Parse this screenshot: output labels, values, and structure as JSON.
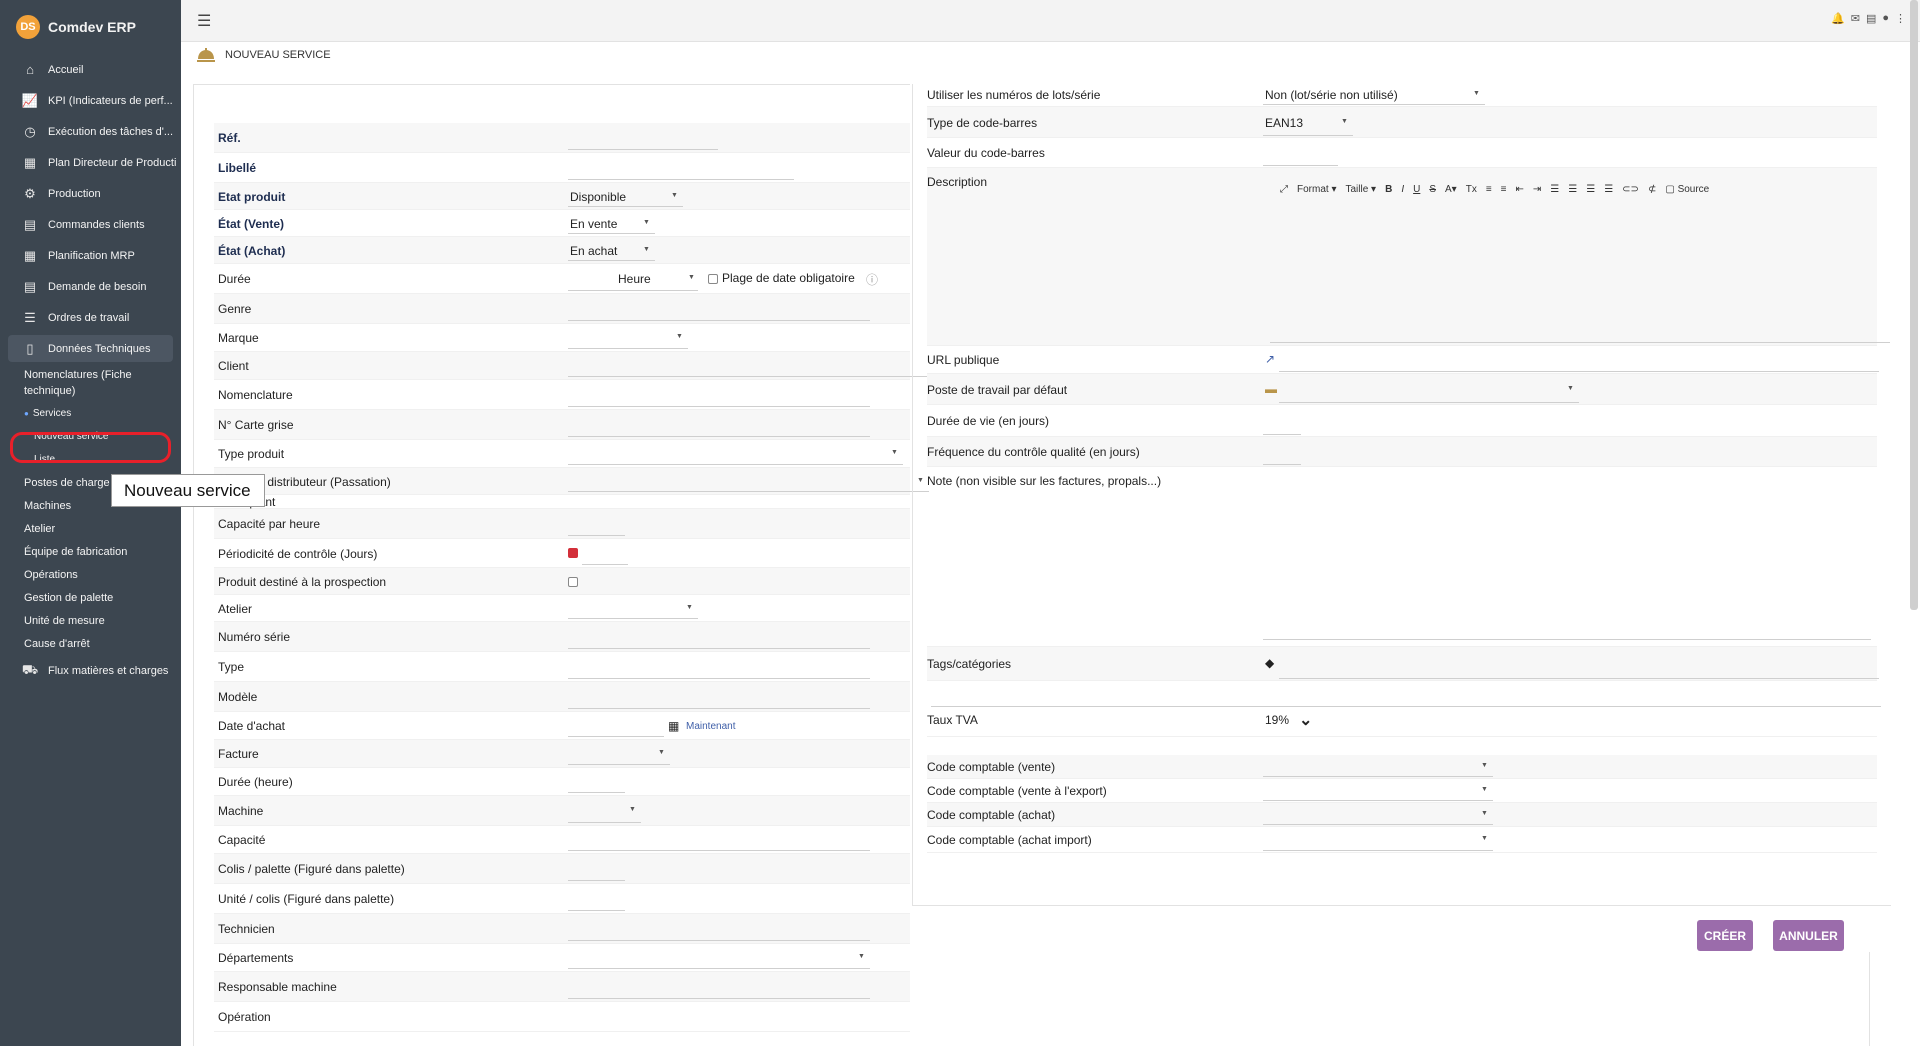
{
  "app": {
    "name": "Comdev ERP",
    "logo_text": "DS"
  },
  "sidebar": {
    "items": [
      {
        "label": "Accueil",
        "icon": "home-icon",
        "glyph": "⌂"
      },
      {
        "label": "KPI (Indicateurs de perf...",
        "icon": "chart-line-icon",
        "glyph": "📈"
      },
      {
        "label": "Exécution des tâches d'...",
        "icon": "clock-icon",
        "glyph": "◷"
      },
      {
        "label": "Plan Directeur de Producti",
        "icon": "calendar-icon",
        "glyph": "▦"
      },
      {
        "label": "Production",
        "icon": "cogs-icon",
        "glyph": "⚙"
      },
      {
        "label": "Commandes clients",
        "icon": "file-icon",
        "glyph": "▤"
      },
      {
        "label": "Planification MRP",
        "icon": "calendar-icon",
        "glyph": "▦"
      },
      {
        "label": "Demande de besoin",
        "icon": "file-icon",
        "glyph": "▤"
      },
      {
        "label": "Ordres de travail",
        "icon": "tasks-icon",
        "glyph": "☰"
      },
      {
        "label": "Données Techniques",
        "icon": "document-icon",
        "glyph": "▯"
      }
    ],
    "sub_nomenclatures": "Nomenclatures (Fiche technique)",
    "sub_services": "Services",
    "sub_nouveau_service": "Nouveau service",
    "sub_liste": "Liste",
    "sub_items": [
      "Postes de charge",
      "Machines",
      "Atelier",
      "Équipe de fabrication",
      "Opérations",
      "Gestion de palette",
      "Unité de mesure",
      "Cause d'arrêt"
    ],
    "flux_label": "Flux matières et charges",
    "flux_glyph": "⛟",
    "tooltip": "Nouveau service"
  },
  "page": {
    "title": "NOUVEAU SERVICE"
  },
  "left_form": {
    "ref": "Réf.",
    "libelle": "Libellé",
    "etat_produit": "Etat produit",
    "etat_produit_val": "Disponible",
    "etat_vente": "État (Vente)",
    "etat_vente_val": "En vente",
    "etat_achat": "État (Achat)",
    "etat_achat_val": "En achat",
    "duree": "Durée",
    "duree_unit": "Heure",
    "plage_date": "Plage de date obligatoire",
    "genre": "Genre",
    "marque": "Marque",
    "client": "Client",
    "nomenclature": "Nomenclature",
    "carte_grise": "N° Carte grise",
    "type_produit": "Type produit",
    "releve": "... relevé distributeur (Passation)",
    "fabriquant": "Fabriquant",
    "capacite_heure": "Capacité par heure",
    "periodicite": "Périodicité de contrôle (Jours)",
    "prospection": "Produit destiné à la prospection",
    "atelier": "Atelier",
    "numero_serie": "Numéro série",
    "type": "Type",
    "modele": "Modèle",
    "date_achat": "Date d'achat",
    "maintenant": "Maintenant",
    "facture": "Facture",
    "duree_heure": "Durée (heure)",
    "machine": "Machine",
    "capacite": "Capacité",
    "colis_palette": "Colis / palette (Figuré dans palette)",
    "unite_colis": "Unité / colis (Figuré dans palette)",
    "technicien": "Technicien",
    "departements": "Départements",
    "responsable": "Responsable machine",
    "operation": "Opération"
  },
  "right_form": {
    "lots": "Utiliser les numéros de lots/série",
    "lots_val": "Non (lot/série non utilisé)",
    "barcode_type": "Type de code-barres",
    "barcode_type_val": "EAN13",
    "barcode_val": "Valeur du code-barres",
    "description": "Description",
    "toolbar": {
      "format": "Format",
      "taille": "Taille",
      "source": "Source"
    },
    "url": "URL publique",
    "poste": "Poste de travail par défaut",
    "duree_vie": "Durée de vie (en jours)",
    "frequence": "Fréquence du contrôle qualité (en jours)",
    "note": "Note (non visible sur les factures, propals...)",
    "tags": "Tags/catégories",
    "tva": "Taux TVA",
    "tva_val": "19%",
    "code_vente": "Code comptable (vente)",
    "code_export": "Code comptable (vente à l'export)",
    "code_achat": "Code comptable (achat)",
    "code_import": "Code comptable (achat import)"
  },
  "buttons": {
    "create": "CRÉER",
    "cancel": "ANNULER"
  },
  "colors": {
    "sidebar_bg": "#3c4650",
    "button_bg": "#9b6cab",
    "label_bold": "#1e2d50",
    "highlight": "#e8202a"
  }
}
